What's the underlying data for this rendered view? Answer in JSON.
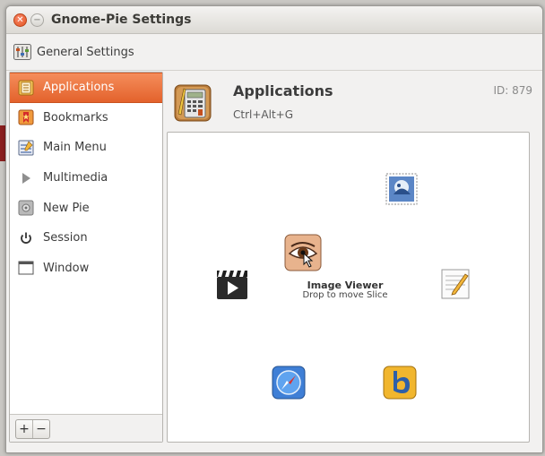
{
  "window": {
    "title": "Gnome-Pie Settings"
  },
  "toolbar": {
    "general_settings_label": "General Settings"
  },
  "sidebar": {
    "items": [
      {
        "label": "Applications",
        "icon": "applications-icon",
        "selected": true
      },
      {
        "label": "Bookmarks",
        "icon": "bookmarks-icon"
      },
      {
        "label": "Main Menu",
        "icon": "main-menu-icon"
      },
      {
        "label": "Multimedia",
        "icon": "play-icon"
      },
      {
        "label": "New Pie",
        "icon": "new-pie-icon"
      },
      {
        "label": "Session",
        "icon": "power-icon"
      },
      {
        "label": "Window",
        "icon": "window-icon"
      }
    ],
    "add_label": "+",
    "remove_label": "−"
  },
  "pie": {
    "name": "Applications",
    "shortcut": "Ctrl+Alt+G",
    "id": "ID: 879"
  },
  "preview": {
    "center_title": "Image Viewer",
    "center_hint": "Drop to move Slice"
  },
  "colors": {
    "selection": "#e8672f",
    "close_button": "#e2541f"
  }
}
